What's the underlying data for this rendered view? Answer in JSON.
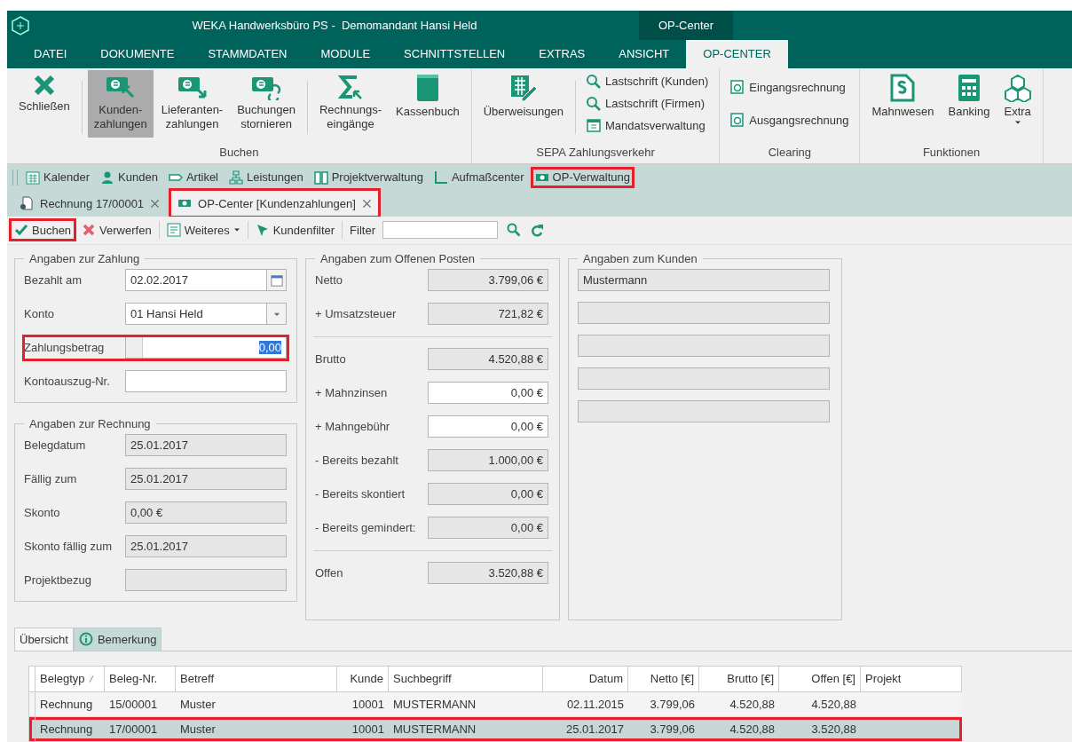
{
  "window": {
    "title": "WEKA Handwerksbüro PS -  Demomandant Hansi Held",
    "context_tab": "OP-Center"
  },
  "menu": [
    {
      "label": "DATEI",
      "selected": false
    },
    {
      "label": "DOKUMENTE",
      "selected": false
    },
    {
      "label": "STAMMDATEN",
      "selected": false
    },
    {
      "label": "MODULE",
      "selected": false
    },
    {
      "label": "SCHNITTSTELLEN",
      "selected": false
    },
    {
      "label": "EXTRAS",
      "selected": false
    },
    {
      "label": "ANSICHT",
      "selected": false
    },
    {
      "label": "OP-CENTER",
      "selected": true
    }
  ],
  "ribbon": {
    "groups": [
      {
        "label": "Buchen",
        "items": [
          {
            "kind": "large",
            "label": "Schließen",
            "selected": false
          },
          {
            "kind": "separator"
          },
          {
            "kind": "large",
            "label": "Kunden-\nzahlungen",
            "selected": true
          },
          {
            "kind": "large",
            "label": "Lieferanten-\nzahlungen",
            "selected": false
          },
          {
            "kind": "large",
            "label": "Buchungen\nstornieren",
            "selected": false
          },
          {
            "kind": "separator"
          },
          {
            "kind": "large",
            "label": "Rechnungs-\neingänge",
            "selected": false
          },
          {
            "kind": "large",
            "label": "Kassenbuch",
            "selected": false
          }
        ]
      },
      {
        "label": "SEPA Zahlungsverkehr",
        "items": [
          {
            "kind": "large",
            "label": "Überweisungen",
            "selected": false
          },
          {
            "kind": "separator"
          },
          {
            "kind": "stack",
            "items": [
              {
                "label": "Lastschrift (Kunden)"
              },
              {
                "label": "Lastschrift (Firmen)"
              },
              {
                "label": "Mandatsverwaltung"
              }
            ]
          }
        ]
      },
      {
        "label": "Clearing",
        "items": [
          {
            "kind": "stack",
            "items": [
              {
                "label": "Eingangsrechnung"
              },
              {
                "label": "Ausgangsrechnung"
              }
            ]
          }
        ]
      },
      {
        "label": "Funktionen",
        "items": [
          {
            "kind": "large",
            "label": "Mahnwesen",
            "selected": false,
            "dropdown": false
          },
          {
            "kind": "large",
            "label": "Banking",
            "selected": false,
            "dropdown": false
          },
          {
            "kind": "large",
            "label": "Extra",
            "selected": false,
            "dropdown": true
          }
        ]
      }
    ]
  },
  "nav": [
    {
      "label": "Kalender",
      "highlighted": false
    },
    {
      "label": "Kunden",
      "highlighted": false
    },
    {
      "label": "Artikel",
      "highlighted": false
    },
    {
      "label": "Leistungen",
      "highlighted": false
    },
    {
      "label": "Projektverwaltung",
      "highlighted": false
    },
    {
      "label": "Aufmaßcenter",
      "highlighted": false
    },
    {
      "label": "OP-Verwaltung",
      "highlighted": true
    }
  ],
  "doc_tabs": [
    {
      "label": "Rechnung 17/00001",
      "selected": false,
      "highlighted": false
    },
    {
      "label": "OP-Center [Kundenzahlungen]",
      "selected": true,
      "highlighted": true
    }
  ],
  "toolbar": [
    {
      "kind": "button",
      "label": "Buchen",
      "highlighted": true
    },
    {
      "kind": "button",
      "label": "Verwerfen",
      "highlighted": false
    },
    {
      "kind": "separator"
    },
    {
      "kind": "menu",
      "label": "Weiteres",
      "highlighted": false
    },
    {
      "kind": "separator"
    },
    {
      "kind": "button",
      "label": "Kundenfilter",
      "highlighted": false
    },
    {
      "kind": "separator"
    },
    {
      "kind": "filter",
      "label": "Filter"
    }
  ],
  "payment": {
    "legend": "Angaben zur Zahlung",
    "rows": [
      {
        "label": "Bezahlt am",
        "kind": "date",
        "value": "02.02.2017",
        "highlighted": false
      },
      {
        "label": "Konto",
        "kind": "select",
        "value": "01 Hansi Held",
        "highlighted": false
      },
      {
        "label": "Zahlungsbetrag",
        "kind": "amount",
        "value": "0,00",
        "text_selected": true,
        "highlighted": true
      },
      {
        "label": "Kontoauszug-Nr.",
        "kind": "text",
        "highlighted": false
      }
    ]
  },
  "invoice": {
    "legend": "Angaben zur Rechnung",
    "rows": [
      {
        "label": "Belegdatum",
        "value": "25.01.2017"
      },
      {
        "label": "Fällig zum",
        "value": "25.01.2017"
      },
      {
        "label": "Skonto",
        "value": "0,00 €"
      },
      {
        "label": "Skonto fällig zum",
        "value": "25.01.2017"
      },
      {
        "label": "Projektbezug"
      }
    ]
  },
  "open_item": {
    "legend": "Angaben zum Offenen Posten",
    "sections": [
      [
        {
          "label": "Netto",
          "value": "3.799,06 €",
          "editable": false
        },
        {
          "label": "+ Umsatzsteuer",
          "value": "721,82 €",
          "editable": false
        }
      ],
      [
        {
          "label": "Brutto",
          "value": "4.520,88 €",
          "editable": false
        },
        {
          "label": "+ Mahnzinsen",
          "value": "0,00 €",
          "editable": true
        },
        {
          "label": "+ Mahngebühr",
          "value": "0,00 €",
          "editable": true
        },
        {
          "label": "- Bereits bezahlt",
          "value": "1.000,00 €",
          "editable": false
        },
        {
          "label": "- Bereits skontiert",
          "value": "0,00 €",
          "editable": false
        },
        {
          "label": "- Bereits gemindert:",
          "value": "0,00 €",
          "editable": false
        }
      ],
      [
        {
          "label": "Offen",
          "value": "3.520,88 €",
          "editable": false
        }
      ]
    ]
  },
  "customer": {
    "legend": "Angaben zum Kunden",
    "fields": [
      {
        "value": "Mustermann"
      }
    ]
  },
  "bottom_tabs": [
    {
      "label": "Übersicht",
      "selected": true
    },
    {
      "label": "Bemerkung",
      "selected": false
    }
  ],
  "table": {
    "columns": [
      {
        "label": "Belegtyp",
        "sorted": true
      },
      {
        "label": "Beleg-Nr.",
        "sorted": false
      },
      {
        "label": "Betreff",
        "sorted": false
      },
      {
        "label": "Kunde",
        "sorted": false
      },
      {
        "label": "Suchbegriff",
        "sorted": false
      },
      {
        "label": "Datum",
        "sorted": false
      },
      {
        "label": "Netto [€]",
        "sorted": false
      },
      {
        "label": "Brutto [€]",
        "sorted": false
      },
      {
        "label": "Offen [€]",
        "sorted": false
      },
      {
        "label": "Projekt",
        "sorted": false
      }
    ],
    "rows": [
      {
        "cells": [
          "Rechnung",
          "15/00001",
          "Muster",
          "10001",
          "MUSTERMANN",
          "02.11.2015",
          "3.799,06",
          "4.520,88",
          "4.520,88"
        ],
        "selected": false,
        "highlighted": false
      },
      {
        "cells": [
          "Rechnung",
          "17/00001",
          "Muster",
          "10001",
          "MUSTERMANN",
          "25.01.2017",
          "3.799,06",
          "4.520,88",
          "3.520,88"
        ],
        "selected": true,
        "highlighted": true
      }
    ]
  }
}
